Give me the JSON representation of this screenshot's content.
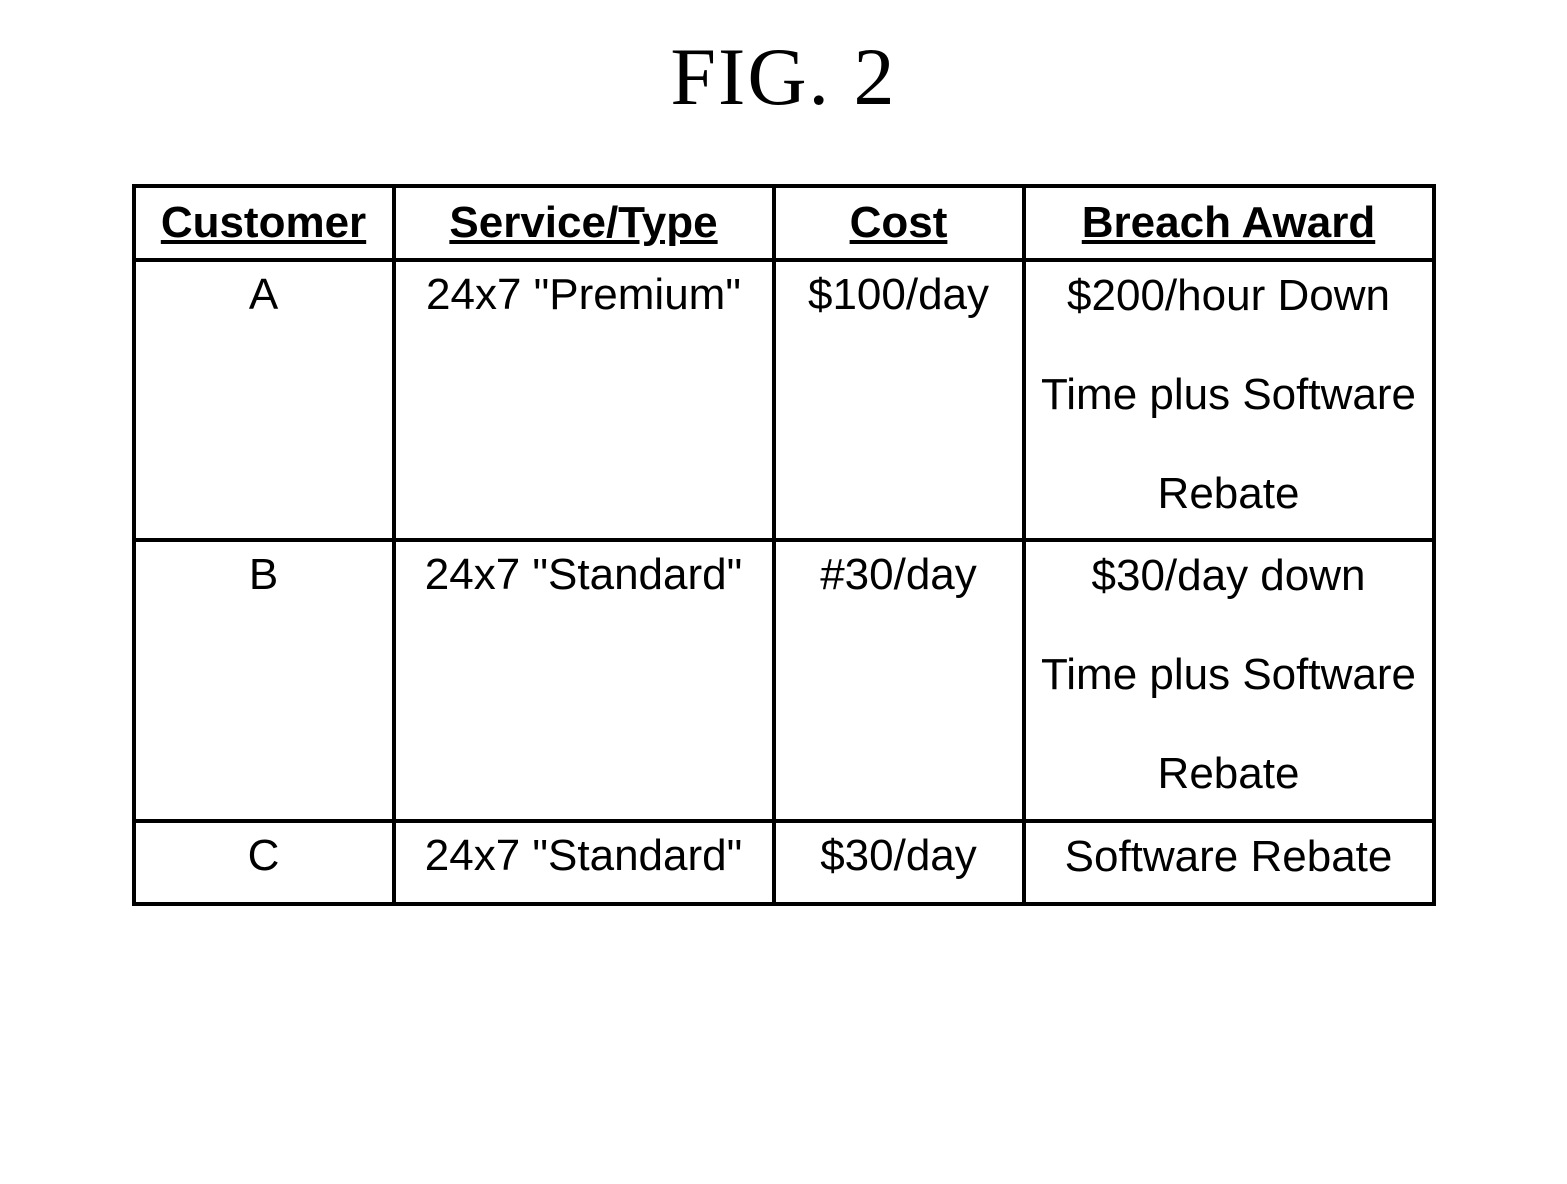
{
  "figure_label": "FIG. 2",
  "table": {
    "headers": {
      "customer": "Customer",
      "service": "Service/Type",
      "cost": "Cost",
      "breach": "Breach Award"
    },
    "rows": [
      {
        "customer": "A",
        "service": "24x7 \"Premium\"",
        "cost": "$100/day",
        "breach_lines": [
          "$200/hour Down",
          "Time plus Software",
          "Rebate"
        ]
      },
      {
        "customer": "B",
        "service": "24x7 \"Standard\"",
        "cost": "#30/day",
        "breach_lines": [
          "$30/day down",
          "Time plus Software",
          "Rebate"
        ]
      },
      {
        "customer": "C",
        "service": "24x7 \"Standard\"",
        "cost": "$30/day",
        "breach_lines": [
          "Software Rebate"
        ]
      }
    ]
  },
  "chart_data": {
    "type": "table",
    "title": "FIG. 2",
    "columns": [
      "Customer",
      "Service/Type",
      "Cost",
      "Breach Award"
    ],
    "rows": [
      [
        "A",
        "24x7 \"Premium\"",
        "$100/day",
        "$200/hour Down Time plus Software Rebate"
      ],
      [
        "B",
        "24x7 \"Standard\"",
        "#30/day",
        "$30/day down Time plus Software Rebate"
      ],
      [
        "C",
        "24x7 \"Standard\"",
        "$30/day",
        "Software Rebate"
      ]
    ]
  }
}
